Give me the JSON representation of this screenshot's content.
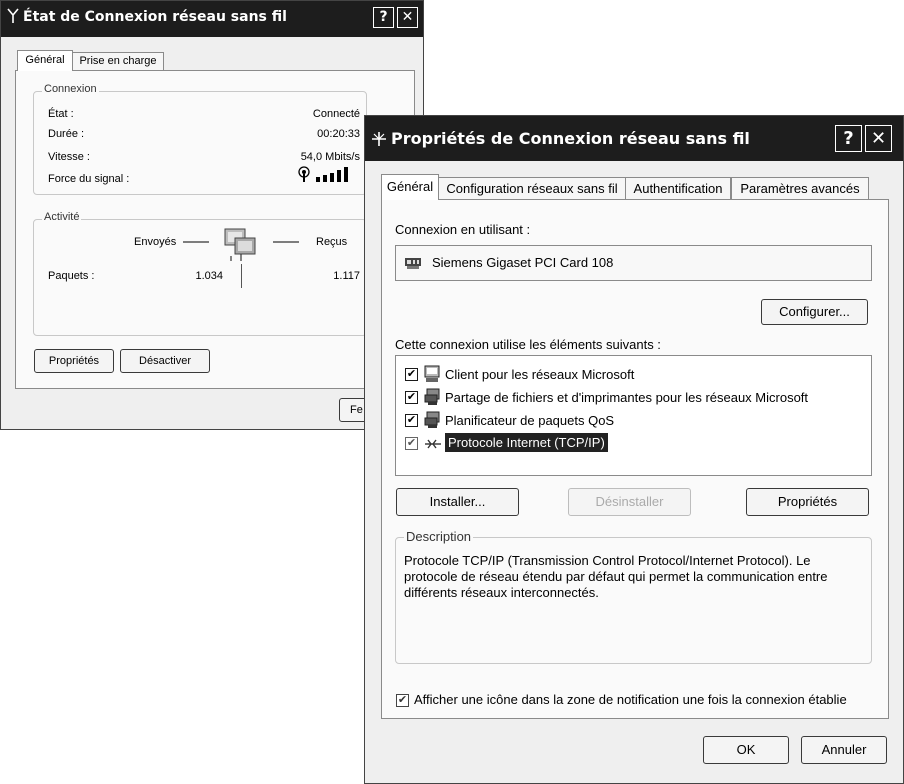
{
  "status_window": {
    "title": "État de Connexion réseau sans fil",
    "title_icon": "antenna-icon",
    "help_btn": "?",
    "close_btn": "✕",
    "tabs": [
      "Général",
      "Prise en charge"
    ],
    "connection": {
      "legend": "Connexion",
      "rows": [
        {
          "label": "État :",
          "value": "Connecté"
        },
        {
          "label": "Durée :",
          "value": "00:20:33"
        },
        {
          "label": "Vitesse :",
          "value": "54,0 Mbits/s"
        },
        {
          "label": "Force du signal :",
          "value": ""
        }
      ],
      "signal_icon": "signal-strength-icon"
    },
    "activity": {
      "legend": "Activité",
      "sent_label": "Envoyés",
      "received_label": "Reçus",
      "packets_label": "Paquets :",
      "packets_sent": "1.034",
      "packets_received": "1.117",
      "network_icon": "network-computers-icon"
    },
    "buttons": {
      "properties": "Propriétés",
      "disable": "Désactiver",
      "close_partial": "Fe"
    }
  },
  "props_window": {
    "title": "Propriétés de Connexion réseau sans fil",
    "title_icon": "antenna-icon",
    "help_btn": "?",
    "close_btn": "✕",
    "tabs": [
      "Général",
      "Configuration réseaux sans fil",
      "Authentification",
      "Paramètres avancés"
    ],
    "connect_using_label": "Connexion en utilisant :",
    "adapter_name": "Siemens Gigaset PCI Card 108",
    "adapter_icon": "network-card-icon",
    "configure_btn": "Configurer...",
    "components_label": "Cette connexion utilise les éléments suivants :",
    "components": [
      {
        "label": "Client pour les réseaux Microsoft",
        "checked": true,
        "icon": "client-icon"
      },
      {
        "label": "Partage de fichiers et d'imprimantes pour les réseaux Microsoft",
        "checked": true,
        "icon": "file-share-icon"
      },
      {
        "label": "Planificateur de paquets QoS",
        "checked": true,
        "icon": "qos-icon"
      },
      {
        "label": "Protocole Internet (TCP/IP)",
        "checked": true,
        "icon": "protocol-icon",
        "selected": true
      }
    ],
    "install_btn": "Installer...",
    "uninstall_btn": "Désinstaller",
    "properties_btn": "Propriétés",
    "description_legend": "Description",
    "description_text": "Protocole TCP/IP (Transmission Control Protocol/Internet Protocol). Le protocole de réseau étendu par défaut qui permet la communication entre différents réseaux interconnectés.",
    "notify_label": "Afficher une icône dans la zone de notification une fois la connexion établie",
    "notify_checked": true,
    "ok_btn": "OK",
    "cancel_btn": "Annuler"
  }
}
